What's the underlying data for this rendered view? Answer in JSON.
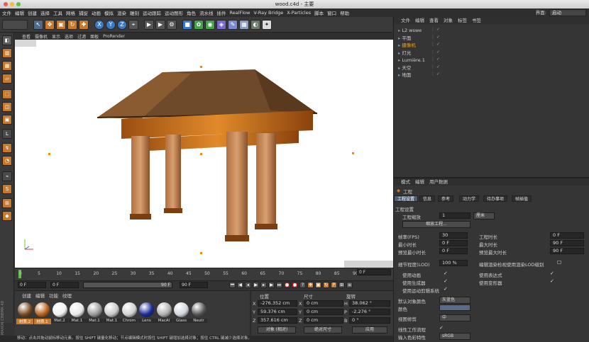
{
  "window": {
    "title": "wood.c4d - 主要",
    "layout_label": "界面:",
    "layout_value": "启动"
  },
  "menu": [
    "文件",
    "编辑",
    "创建",
    "选择",
    "工具",
    "网格",
    "捕捉",
    "动画",
    "模拟",
    "渲染",
    "雕刻",
    "运动跟踪",
    "运动图形",
    "角色",
    "流水线",
    "插件",
    "RealFlow",
    "V-Ray Bridge",
    "X-Particles",
    "脚本",
    "窗口",
    "帮助"
  ],
  "viewport": {
    "menu": [
      "查看",
      "摄像机",
      "显示",
      "选项",
      "过滤",
      "面板",
      "ProRender"
    ]
  },
  "timeline": {
    "ticks": [
      "0",
      "5",
      "10",
      "15",
      "20",
      "25",
      "30",
      "35",
      "40",
      "45",
      "50",
      "55",
      "60",
      "65",
      "70",
      "75",
      "80",
      "85",
      "90"
    ],
    "current_frame": "0 F",
    "start": "0 F",
    "range_start": "0 F",
    "range_end": "90 F",
    "end": "90 F"
  },
  "materials": {
    "menu": [
      "创建",
      "编辑",
      "功能",
      "纹理"
    ],
    "items": [
      {
        "label": "材质.2",
        "color": "#7a4a22"
      },
      {
        "label": "材质.1",
        "color": "#b8611b"
      },
      {
        "label": "Mat.2",
        "color": "#f0f0f0"
      },
      {
        "label": "Mat.1",
        "color": "#e8e8e8"
      },
      {
        "label": "Mat.1",
        "color": "#9a9a9a"
      },
      {
        "label": "Mat.1",
        "color": "#c8c8c8"
      },
      {
        "label": "Chrom",
        "color": "#d0d0d0"
      },
      {
        "label": "Lens",
        "color": "#1a2a9a"
      },
      {
        "label": "MacAl",
        "color": "#b0b0b0"
      },
      {
        "label": "Glass",
        "color": "#cfd6dc"
      },
      {
        "label": "Neutr",
        "color": "#555555"
      }
    ],
    "watermark": "MAXON CINEMA 4D"
  },
  "coords": {
    "headers": [
      "位置",
      "尺寸",
      "旋转"
    ],
    "rows": [
      {
        "axis": "X",
        "pos": "-276.352 cm",
        "size_axis": "X",
        "size": "0 cm",
        "rot_axis": "H",
        "rot": "38.062 °"
      },
      {
        "axis": "Y",
        "pos": "59.376 cm",
        "size_axis": "Y",
        "size": "0 cm",
        "rot_axis": "P",
        "rot": "-2.276 °"
      },
      {
        "axis": "Z",
        "pos": "357.616 cm",
        "size_axis": "Z",
        "size": "0 cm",
        "rot_axis": "B",
        "rot": "0 °"
      }
    ],
    "mode1": "对象 (相对)",
    "mode2": "绝对尺寸",
    "apply": "应用"
  },
  "objects": {
    "menu": [
      "文件",
      "编辑",
      "查看",
      "对象",
      "标签",
      "书签"
    ],
    "items": [
      {
        "name": "L2 wswe",
        "color": "#cfcfcf"
      },
      {
        "name": "平面",
        "color": "#cfcfcf"
      },
      {
        "name": "摄像机",
        "color": "#f0a020"
      },
      {
        "name": "灯光",
        "color": "#cfcfcf"
      },
      {
        "name": "Lumière.1",
        "color": "#cfcfcf"
      },
      {
        "name": "天空",
        "color": "#cfcfcf"
      },
      {
        "name": "地面",
        "color": "#cfcfcf"
      }
    ]
  },
  "attributes": {
    "menu": [
      "模式",
      "编辑",
      "用户数据"
    ],
    "header": "工程",
    "tabs": [
      "工程设置",
      "信息",
      "参考",
      "动力学",
      "待办事项",
      "帧插值"
    ],
    "section": "工程设置",
    "scale_label": "工程缩放",
    "scale_value": "1",
    "scale_unit": "厘米",
    "scale_button": "缩放工程...",
    "left_fields": [
      {
        "label": "帧率(FPS)",
        "value": "30"
      },
      {
        "label": "最小时长",
        "value": "0 F"
      },
      {
        "label": "预览最小时长",
        "value": "0 F"
      },
      {
        "label": "细节程度(LOD)",
        "value": "100 %"
      }
    ],
    "right_fields": [
      {
        "label": "工程时长",
        "value": "0 F"
      },
      {
        "label": "最大时长",
        "value": "90 F"
      },
      {
        "label": "预览最大时长",
        "value": "90 F"
      }
    ],
    "lod_option": "编辑渲染检视使用渲染LOD级别",
    "checks_left": [
      "使用动画",
      "使用生成器",
      "使用运动剪辑系统"
    ],
    "checks_right": [
      "使用表达式",
      "使用变形器"
    ],
    "default_color_label": "默认对象颜色",
    "default_color_value": "灰蓝色",
    "color_label": "颜色",
    "view_clip_label": "视图修剪",
    "view_clip_value": "中",
    "linear_label": "线性工作流程",
    "input_color_label": "输入色彩特性",
    "input_color_value": "sRGB"
  },
  "status": "移动：点击并拖动鼠标移动元素。按住 SHIFT 键量化移动；节点编辑模式时按住 SHIFT 键增加选择对象；按住 CTRL 键减少选择对象。"
}
